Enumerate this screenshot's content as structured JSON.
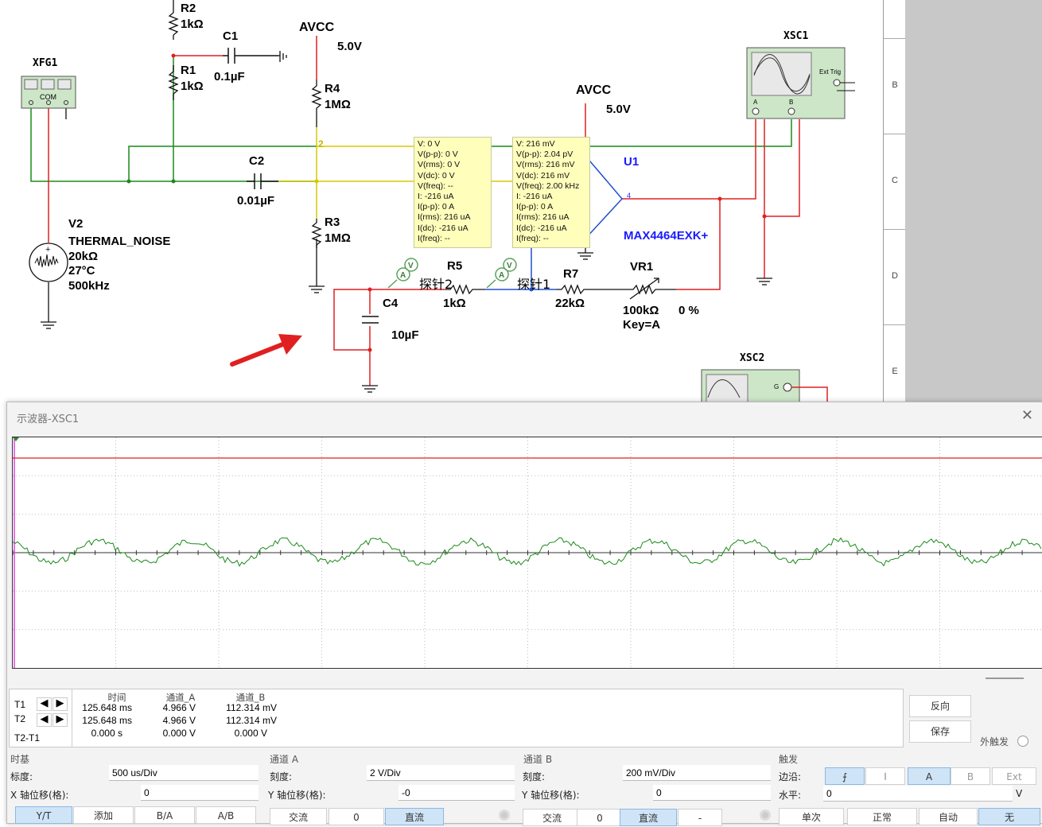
{
  "schematic": {
    "components": {
      "xfg1": {
        "name": "XFG1",
        "com": "COM"
      },
      "r2": {
        "name": "R2",
        "value": "1kΩ"
      },
      "c1": {
        "name": "C1",
        "value": "0.1µF"
      },
      "r1": {
        "name": "R1",
        "value": "1kΩ"
      },
      "avcc1": {
        "name": "AVCC",
        "value": "5.0V"
      },
      "r4": {
        "name": "R4",
        "value": "1MΩ"
      },
      "c2": {
        "name": "C2",
        "value": "0.01µF"
      },
      "r3": {
        "name": "R3",
        "value": "1MΩ"
      },
      "v2": {
        "name": "V2",
        "type": "THERMAL_NOISE",
        "r": "20kΩ",
        "temp": "27°C",
        "bw": "500kHz"
      },
      "avcc2": {
        "name": "AVCC",
        "value": "5.0V"
      },
      "u1": {
        "name": "U1",
        "part": "MAX4464EXK+",
        "pin": "4"
      },
      "c4": {
        "name": "C4",
        "value": "10µF"
      },
      "r5": {
        "name": "R5",
        "value": "1kΩ"
      },
      "r7": {
        "name": "R7",
        "value": "22kΩ"
      },
      "vr1": {
        "name": "VR1",
        "value": "100kΩ",
        "percent": "0 %",
        "key": "Key=A"
      },
      "xsc1": {
        "name": "XSC1",
        "ext_trig": "Ext Trig",
        "a": "A",
        "b": "B"
      },
      "xsc2": {
        "name": "XSC2",
        "g": "G"
      },
      "node2": "2"
    },
    "probe2_label": "探针2",
    "probe1_label": "探针1",
    "probe_box_left": [
      "V: 0 V",
      "V(p-p): 0 V",
      "V(rms): 0 V",
      "V(dc): 0 V",
      "V(freq): --",
      "I: -216 uA",
      "I(p-p): 0 A",
      "I(rms): 216 uA",
      "I(dc): -216 uA",
      "I(freq): --"
    ],
    "probe_box_right": [
      "V: 216 mV",
      "V(p-p): 2.04 pV",
      "V(rms): 216 mV",
      "V(dc): 216 mV",
      "V(freq): 2.00 kHz",
      "I: -216 uA",
      "I(p-p): 0 A",
      "I(rms): 216 uA",
      "I(dc): -216 uA",
      "I(freq): --"
    ],
    "ruler": [
      "B",
      "C",
      "D",
      "E"
    ],
    "colors": {
      "wire_green": "#1a8a1a",
      "wire_red": "#e02020",
      "wire_yellow": "#d8c800",
      "wire_blue": "#2050d0",
      "probe_bg": "#ffffbb"
    }
  },
  "scope": {
    "title": "示波器-XSC1",
    "close": "✕",
    "colors": {
      "channel_a": "#e02020",
      "channel_b": "#1a8a1a"
    },
    "readout": {
      "headers": {
        "time": "时间",
        "ch_a": "通道_A",
        "ch_b": "通道_B"
      },
      "rows": [
        {
          "label": "T1",
          "time": "125.648 ms",
          "a": "4.966 V",
          "b": "112.314 mV"
        },
        {
          "label": "T2",
          "time": "125.648 ms",
          "a": "4.966 V",
          "b": "112.314 mV"
        },
        {
          "label": "T2-T1",
          "time": "0.000 s",
          "a": "0.000 V",
          "b": "0.000 V"
        }
      ]
    },
    "side_buttons": {
      "reverse": "反向",
      "save": "保存",
      "ext_trigger": "外触发"
    },
    "timebase": {
      "title": "时基",
      "scale_label": "标度:",
      "scale": "500 us/Div",
      "xpos_label": "X 轴位移(格):",
      "xpos": "0",
      "modes": [
        "Y/T",
        "添加",
        "B/A",
        "A/B"
      ],
      "selected": "Y/T"
    },
    "channel_a": {
      "title": "通道 A",
      "scale_label": "刻度:",
      "scale": "2  V/Div",
      "ypos_label": "Y 轴位移(格):",
      "ypos": "-0",
      "coupling": [
        "交流",
        "0",
        "直流"
      ],
      "selected": "直流"
    },
    "channel_b": {
      "title": "通道 B",
      "scale_label": "刻度:",
      "scale": "200 mV/Div",
      "ypos_label": "Y 轴位移(格):",
      "ypos": "0",
      "coupling": [
        "交流",
        "0",
        "直流",
        "-"
      ],
      "selected": "直流"
    },
    "trigger": {
      "title": "触发",
      "edge_label": "边沿:",
      "level_label": "水平:",
      "level": "0",
      "level_unit": "V",
      "edge_rise": "⨍",
      "edge_fall": "⦚",
      "sources": [
        "A",
        "B",
        "Ext"
      ],
      "source_selected": "A",
      "modes": [
        "单次",
        "正常",
        "自动",
        "无"
      ],
      "mode_selected": "无"
    }
  }
}
